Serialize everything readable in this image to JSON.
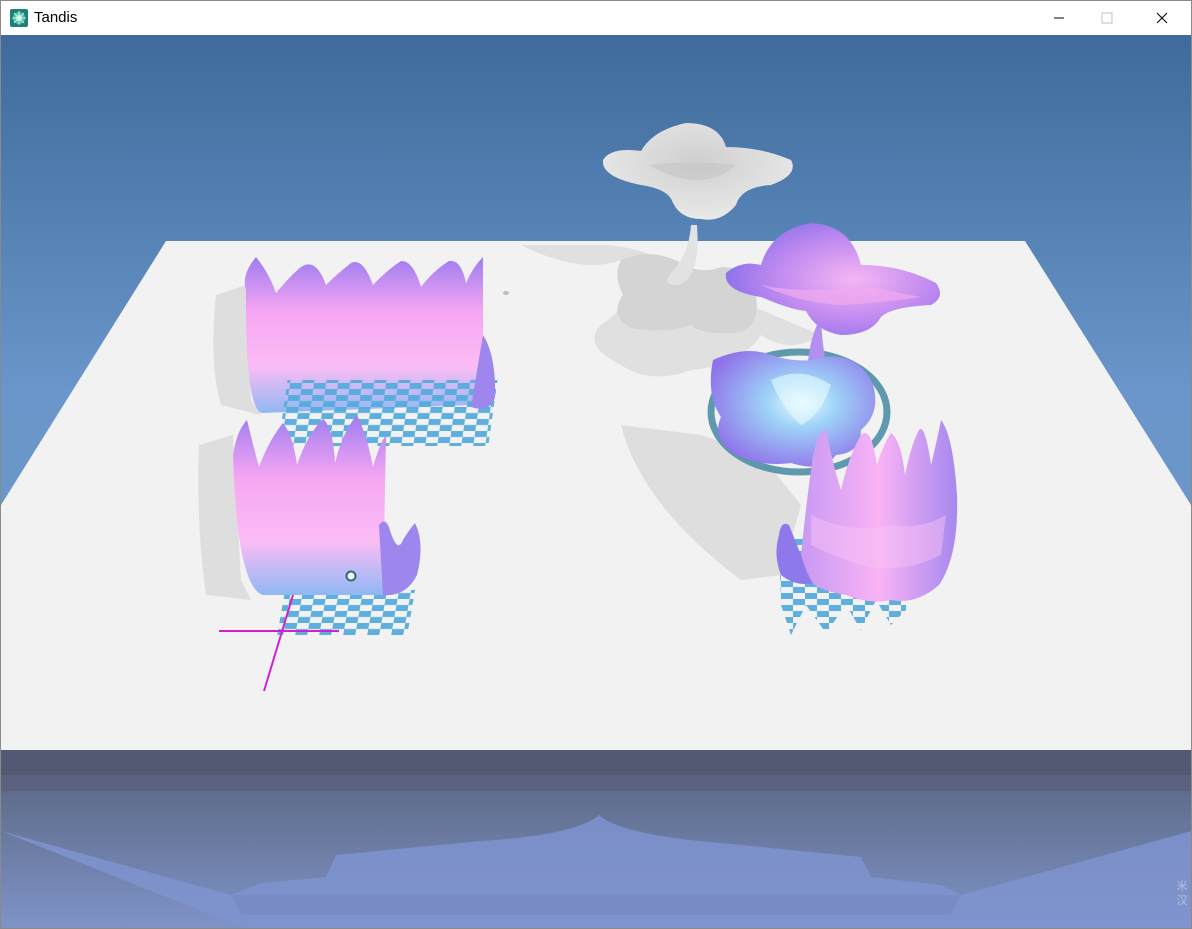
{
  "window": {
    "title": "Tandis",
    "controls": {
      "minimize": "minimize",
      "maximize": "maximize",
      "close": "close"
    }
  },
  "scene": {
    "sky_top": "#3d6a9a",
    "sky_bottom": "#6f9ad0",
    "table_color": "#f2f2f2",
    "surface_colors": [
      "#f6a8f0",
      "#b58cf0",
      "#9fd0f7"
    ],
    "checker_color": "#4aa6d8",
    "gizmo_color": "#d020d0",
    "side_text": "米 汉"
  }
}
